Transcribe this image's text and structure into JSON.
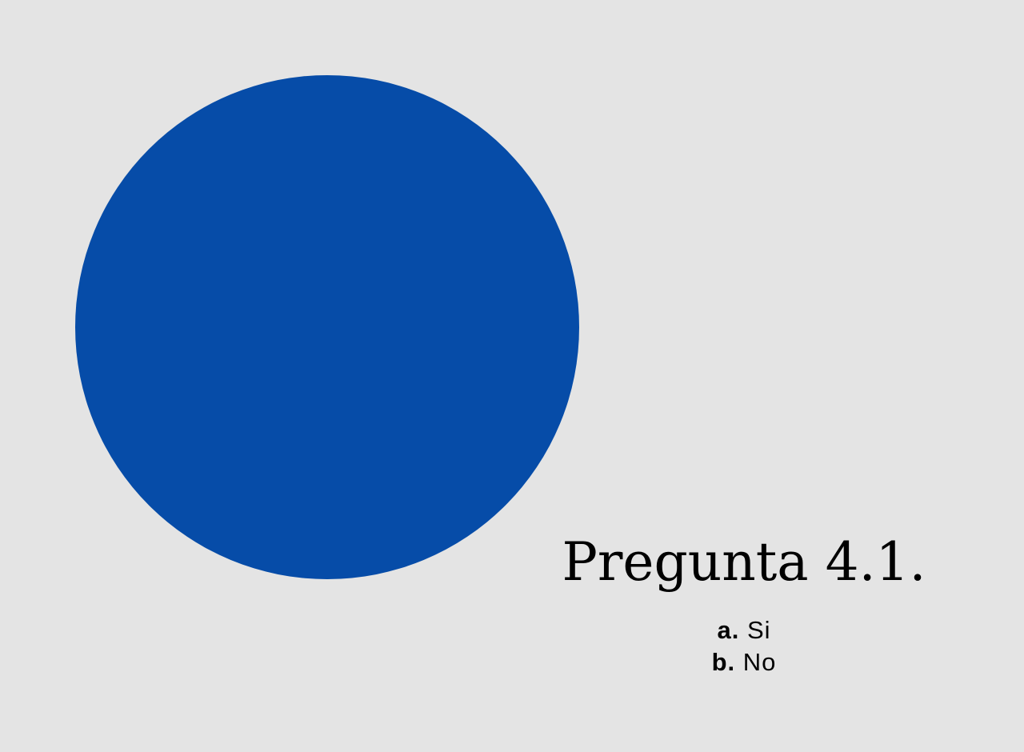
{
  "chart_data": {
    "type": "pie",
    "title": "Pregunta 4.1.",
    "categories": [
      "Si",
      "No"
    ],
    "values": [
      100,
      0
    ],
    "colors": [
      "#064ca8",
      "#0a4a9e"
    ],
    "legend": [
      {
        "key": "a.",
        "label": "Si"
      },
      {
        "key": "b.",
        "label": "No"
      }
    ],
    "legend_placement": "bottom-right"
  },
  "page": {
    "background": "#e4e4e4"
  }
}
